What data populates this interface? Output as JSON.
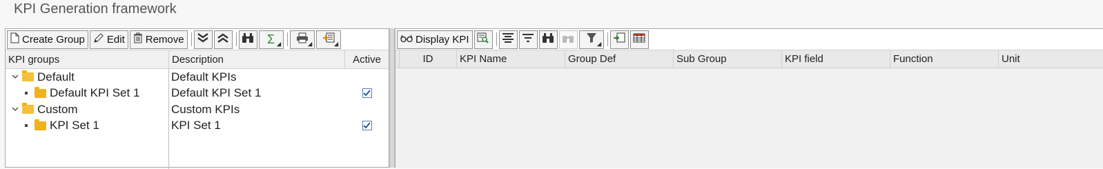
{
  "app": {
    "title": "KPI Generation framework"
  },
  "left_toolbar": {
    "create_group": "Create Group",
    "edit": "Edit",
    "remove": "Remove"
  },
  "left_grid": {
    "headers": {
      "groups": "KPI groups",
      "description": "Description",
      "active": "Active"
    },
    "rows": [
      {
        "name": "Default",
        "description": "Default KPIs",
        "level": 0,
        "active": null
      },
      {
        "name": "Default KPI Set 1",
        "description": "Default KPI Set 1",
        "level": 1,
        "active": true
      },
      {
        "name": "Custom",
        "description": "Custom KPIs",
        "level": 0,
        "active": null
      },
      {
        "name": "KPI Set 1",
        "description": "KPI Set 1",
        "level": 1,
        "active": true
      }
    ]
  },
  "right_toolbar": {
    "display_kpi": "Display KPI"
  },
  "right_grid": {
    "headers": [
      "ID",
      "KPI Name",
      "Group Def",
      "Sub Group",
      "KPI field",
      "Function",
      "Unit"
    ]
  },
  "colors": {
    "folder": "#f2b21b",
    "checkbox_border": "#5a7fb5",
    "sum_icon": "#2e8b2e"
  }
}
